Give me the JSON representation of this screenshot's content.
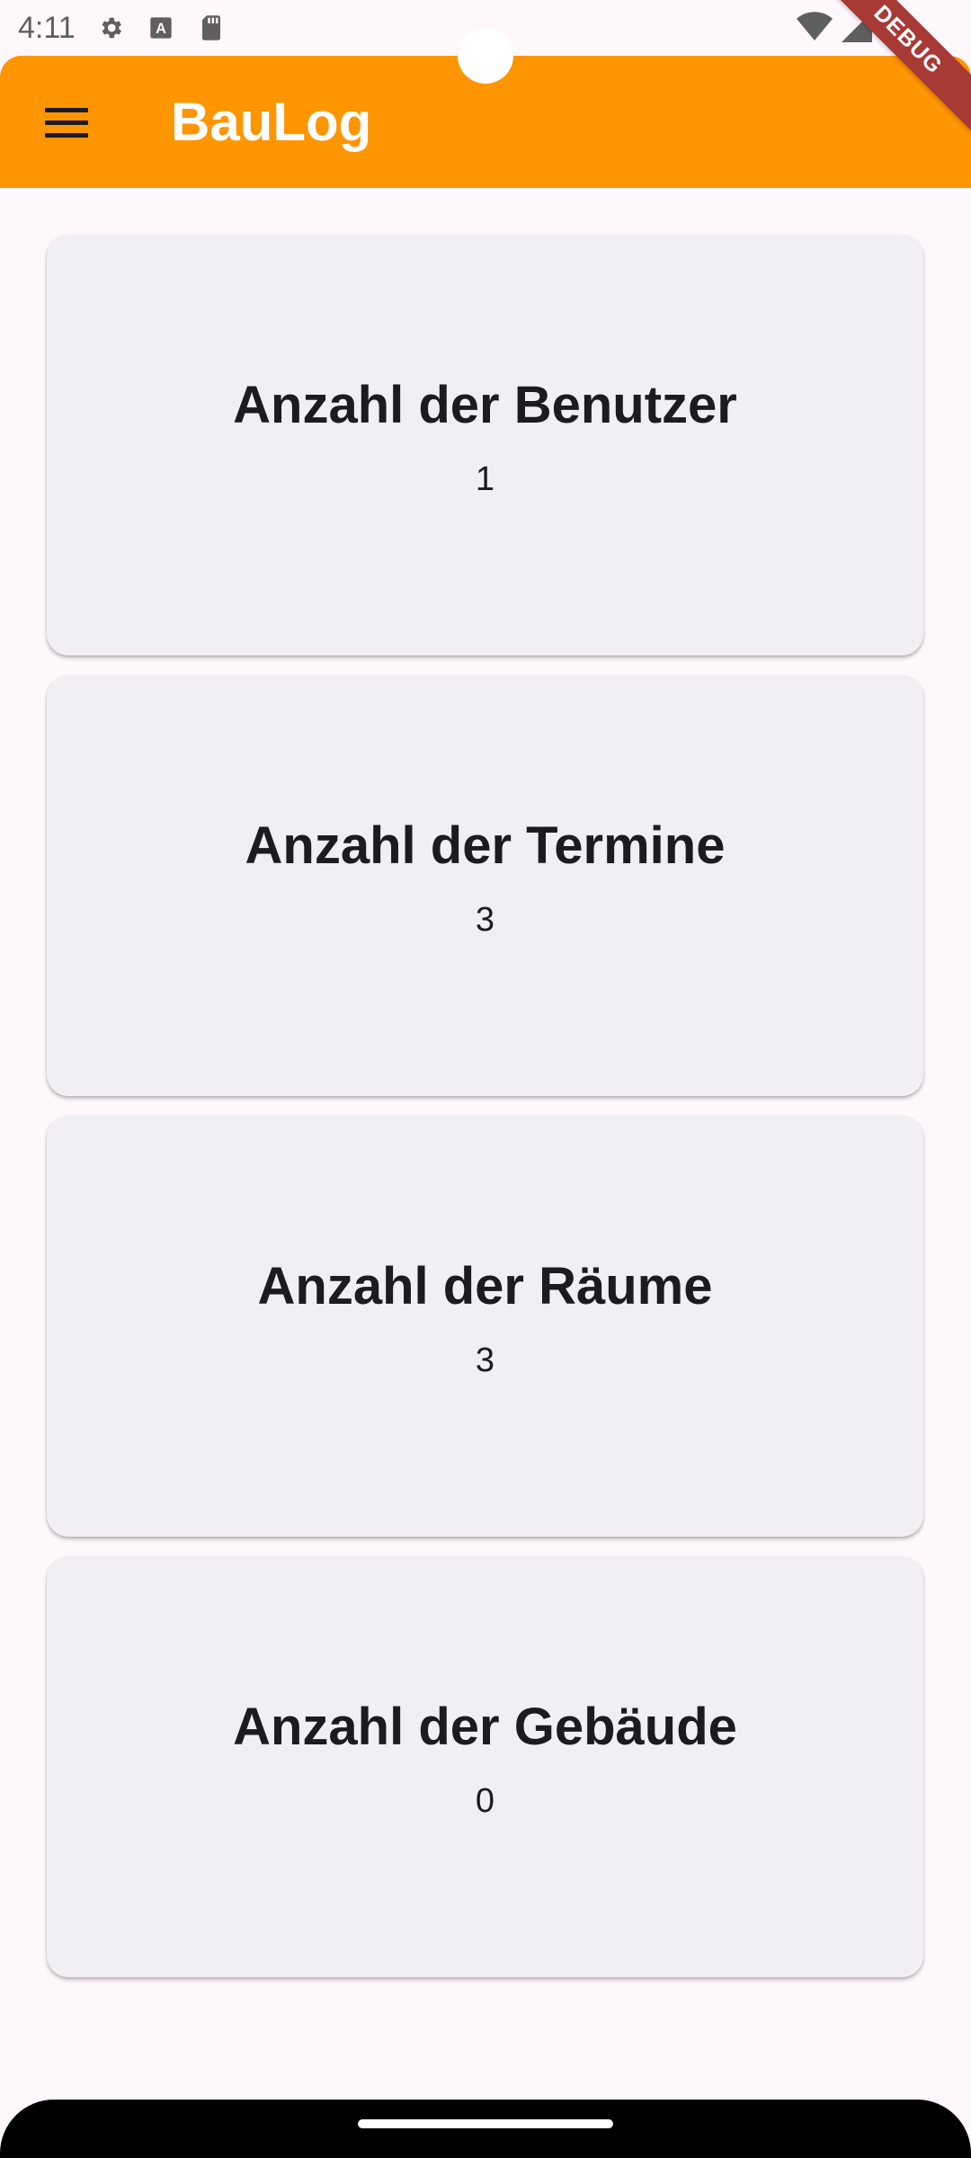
{
  "status_bar": {
    "time": "4:11",
    "icons_left": [
      "gear-icon",
      "font-a-icon",
      "sd-card-icon"
    ],
    "icons_right": [
      "wifi-icon",
      "signal-icon"
    ]
  },
  "app_bar": {
    "title": "BauLog",
    "menu_icon": "hamburger-menu-icon",
    "background_color": "#ff9500"
  },
  "debug_banner": {
    "label": "DEBUG"
  },
  "cards": [
    {
      "title": "Anzahl der Benutzer",
      "value": "1"
    },
    {
      "title": "Anzahl der Termine",
      "value": "3"
    },
    {
      "title": "Anzahl der Räume",
      "value": "3"
    },
    {
      "title": "Anzahl der Gebäude",
      "value": "0"
    }
  ]
}
